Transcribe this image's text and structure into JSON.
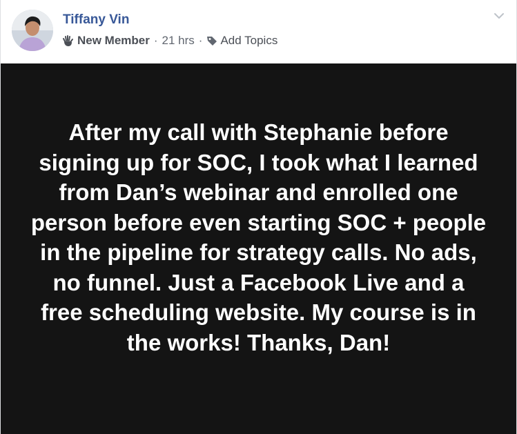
{
  "post": {
    "author": {
      "name": "Tiffany Vin",
      "avatar_icon": "profile-photo"
    },
    "meta": {
      "badge_icon": "waving-hand-icon",
      "badge_label": "New Member",
      "separator": "·",
      "timestamp": "21 hrs",
      "tag_icon": "tag-icon",
      "add_topics_label": "Add Topics"
    },
    "menu_icon": "chevron-down-icon",
    "card": {
      "background_color": "#141414",
      "text_color": "#ffffff",
      "text": "After my call with Stephanie before signing up for SOC, I took what I learned from Dan’s webinar and enrolled one person before even starting SOC + people in the pipeline for strategy calls. No ads, no funnel. Just a Facebook Live and a free scheduling website. My course is in the works! Thanks, Dan!"
    },
    "colors": {
      "author_link": "#385898",
      "meta_text": "#616770"
    }
  }
}
